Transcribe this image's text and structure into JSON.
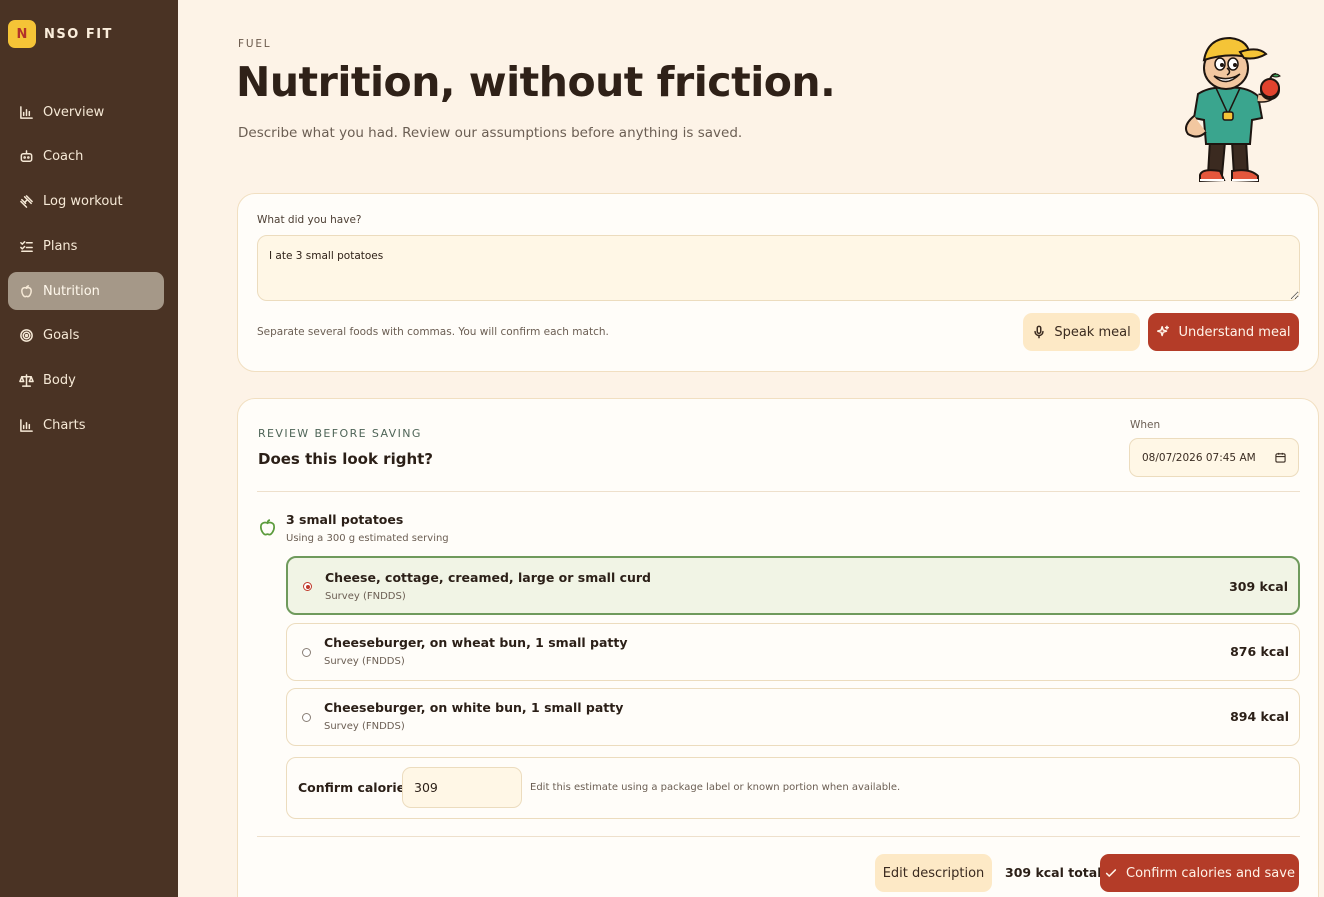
{
  "brand": {
    "badge": "N",
    "name": "NSO FIT"
  },
  "sidebar": {
    "items": [
      {
        "label": "Overview",
        "icon": "bar-chart-icon",
        "active": false
      },
      {
        "label": "Coach",
        "icon": "robot-icon",
        "active": false
      },
      {
        "label": "Log workout",
        "icon": "dumbbell-icon",
        "active": false
      },
      {
        "label": "Plans",
        "icon": "checklist-icon",
        "active": false
      },
      {
        "label": "Nutrition",
        "icon": "apple-icon",
        "active": true
      },
      {
        "label": "Goals",
        "icon": "target-icon",
        "active": false
      },
      {
        "label": "Body",
        "icon": "scale-icon",
        "active": false
      },
      {
        "label": "Charts",
        "icon": "bar-chart-icon",
        "active": false
      }
    ]
  },
  "header": {
    "eyebrow": "FUEL",
    "title": "Nutrition, without friction.",
    "subtitle": "Describe what you had. Review our assumptions before anything is saved."
  },
  "meal_input": {
    "label": "What did you have?",
    "value": "I ate 3 small potatoes",
    "hint": "Separate several foods with commas. You will confirm each match.",
    "speak_label": "Speak meal",
    "understand_label": "Understand meal"
  },
  "review": {
    "eyebrow": "REVIEW BEFORE SAVING",
    "title": "Does this look right?",
    "when_label": "When",
    "when_value": "08/07/2026 07:45 AM",
    "food": {
      "name": "3 small potatoes",
      "note": "Using a 300 g estimated serving"
    },
    "options": [
      {
        "name": "Cheese, cottage, creamed, large or small curd",
        "source": "Survey (FNDDS)",
        "kcal": "309 kcal",
        "selected": true
      },
      {
        "name": "Cheeseburger, on wheat bun, 1 small patty",
        "source": "Survey (FNDDS)",
        "kcal": "876 kcal",
        "selected": false
      },
      {
        "name": "Cheeseburger, on white bun, 1 small patty",
        "source": "Survey (FNDDS)",
        "kcal": "894 kcal",
        "selected": false
      }
    ],
    "confirm": {
      "label": "Confirm calories",
      "value": "309",
      "hint": "Edit this estimate using a package label or known portion when available."
    },
    "footer": {
      "edit_label": "Edit description",
      "total": "309 kcal total",
      "save_label": "Confirm calories and save"
    }
  },
  "colors": {
    "sidebar_bg": "#4a3324",
    "page_bg": "#fdf3e7",
    "accent": "#b43c28",
    "selected_border": "#6f9a5c",
    "brand_yellow": "#f5c437"
  }
}
